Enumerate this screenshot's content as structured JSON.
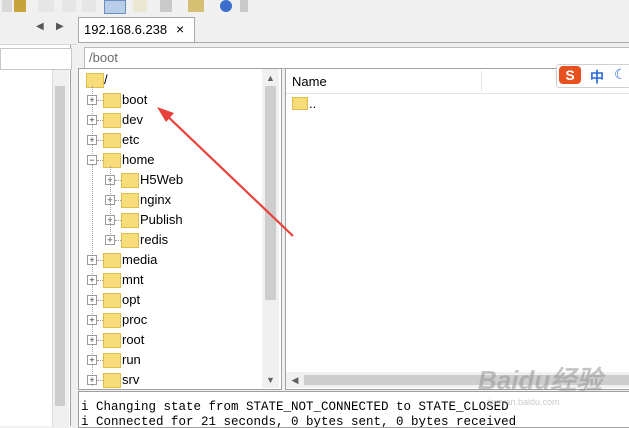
{
  "tab": {
    "title": "192.168.6.238",
    "close_glyph": "×"
  },
  "path_bar": {
    "value": "/boot"
  },
  "tree": {
    "root": "/",
    "items": [
      {
        "label": "boot",
        "level": 1,
        "expander": "+"
      },
      {
        "label": "dev",
        "level": 1,
        "expander": "+"
      },
      {
        "label": "etc",
        "level": 1,
        "expander": "+"
      },
      {
        "label": "home",
        "level": 1,
        "expander": "−"
      },
      {
        "label": "H5Web",
        "level": 2,
        "expander": "+"
      },
      {
        "label": "nginx",
        "level": 2,
        "expander": "+"
      },
      {
        "label": "Publish",
        "level": 2,
        "expander": "+"
      },
      {
        "label": "redis",
        "level": 2,
        "expander": "+"
      },
      {
        "label": "media",
        "level": 1,
        "expander": "+"
      },
      {
        "label": "mnt",
        "level": 1,
        "expander": "+"
      },
      {
        "label": "opt",
        "level": 1,
        "expander": "+"
      },
      {
        "label": "proc",
        "level": 1,
        "expander": "+"
      },
      {
        "label": "root",
        "level": 1,
        "expander": "+"
      },
      {
        "label": "run",
        "level": 1,
        "expander": "+"
      },
      {
        "label": "srv",
        "level": 1,
        "expander": "+"
      }
    ]
  },
  "list": {
    "columns": [
      "Name"
    ],
    "items": [
      ".."
    ]
  },
  "ime": {
    "logo": "S",
    "lang": "中",
    "mode_icon": "moon-icon"
  },
  "log": {
    "lines": [
      "i Changing state from STATE_NOT_CONNECTED to STATE_CLOSED",
      "i Connected for 21 seconds, 0 bytes sent, 0 bytes received"
    ]
  },
  "watermark": {
    "text": "Baidu经验",
    "sub": "jingyan.baidu.com"
  },
  "colors": {
    "folder": "#f7dc7a",
    "arrow": "#e8403a",
    "ime_brand": "#e8501e",
    "ime_accent": "#2a6ad8"
  }
}
